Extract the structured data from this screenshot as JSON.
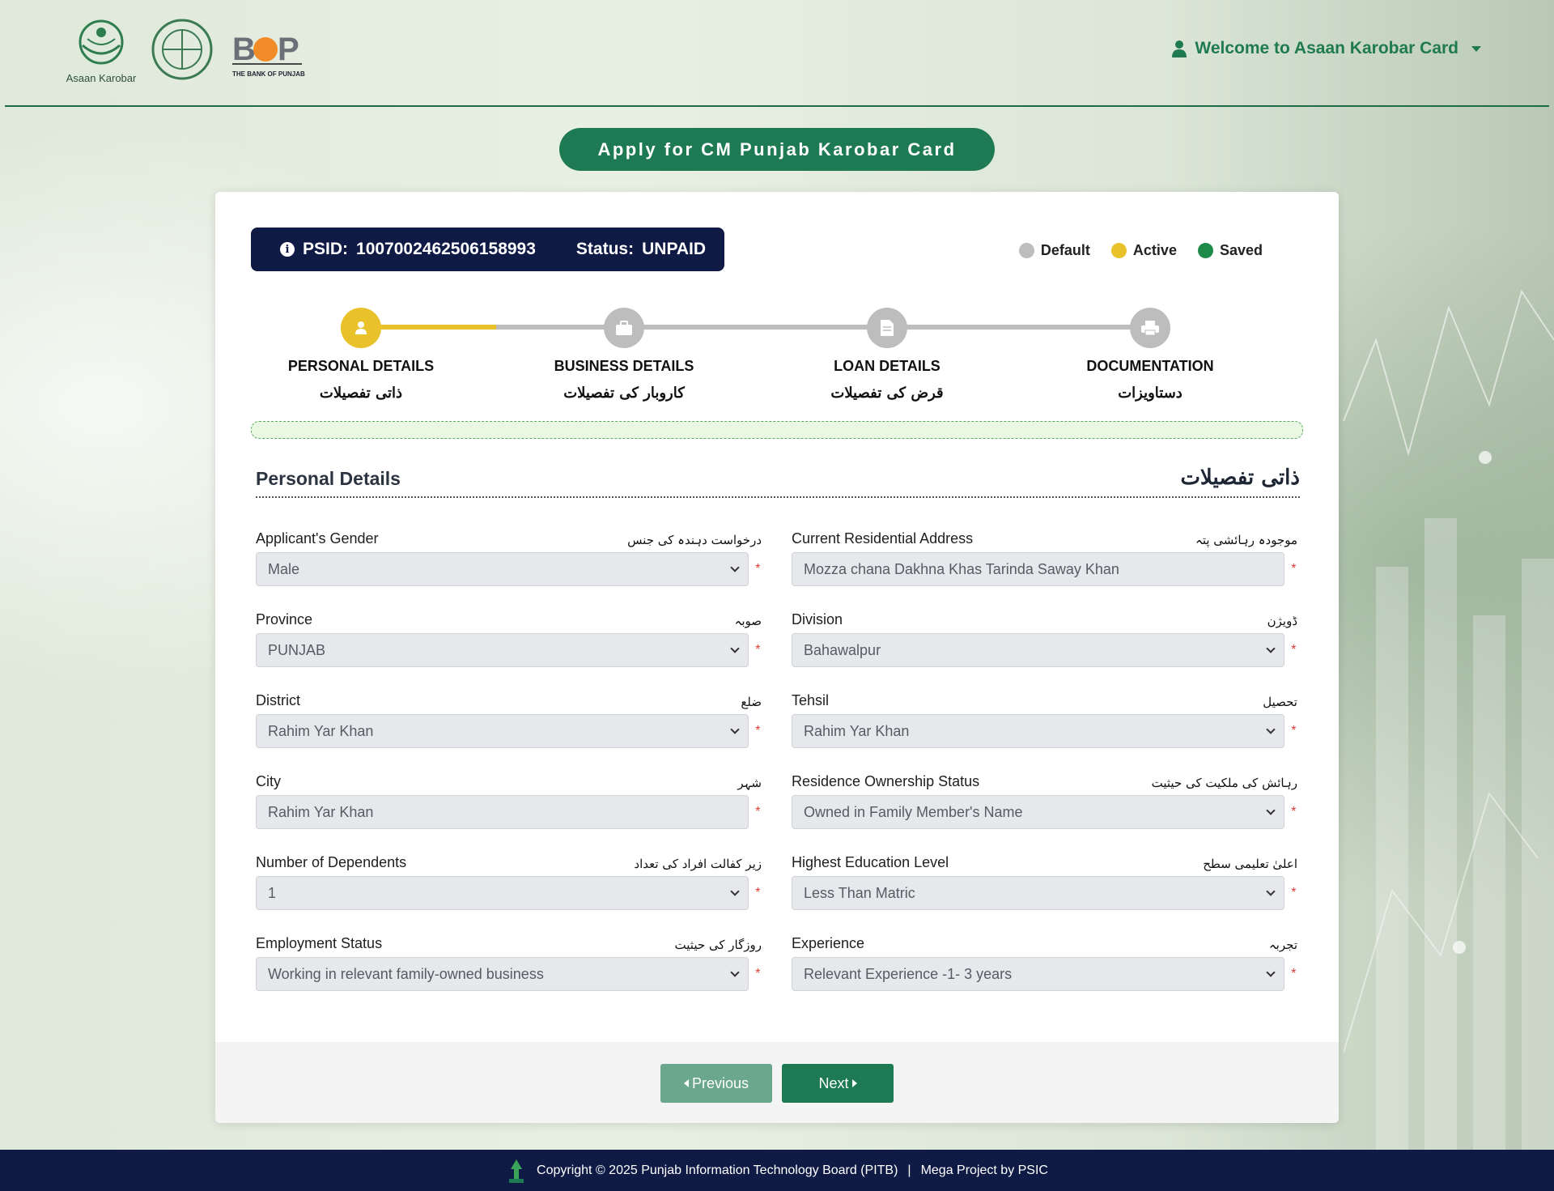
{
  "header": {
    "logo1_caption": "Asaan Karobar",
    "logo3_text": "BOP",
    "logo3_caption": "THE BANK OF PUNJAB",
    "welcome": "Welcome to Asaan Karobar Card"
  },
  "apply_title": "Apply for CM Punjab Karobar Card",
  "status_box": {
    "psid_label": "PSID:",
    "psid_value": "1007002462506158993",
    "status_label": "Status:",
    "status_value": "UNPAID"
  },
  "legend": [
    {
      "label": "Default",
      "color": "#bdbdbd"
    },
    {
      "label": "Active",
      "color": "#e9c12a"
    },
    {
      "label": "Saved",
      "color": "#1d8a4a"
    }
  ],
  "steps": [
    {
      "title": "PERSONAL DETAILS",
      "urdu": "ذاتی تفصیلات",
      "state": "active",
      "icon": "person-icon"
    },
    {
      "title": "BUSINESS DETAILS",
      "urdu": "کاروبار کی تفصیلات",
      "state": "default",
      "icon": "briefcase-icon"
    },
    {
      "title": "LOAN DETAILS",
      "urdu": "قرض کی تفصیلات",
      "state": "default",
      "icon": "document-icon"
    },
    {
      "title": "DOCUMENTATION",
      "urdu": "دستاویزات",
      "state": "default",
      "icon": "printer-icon"
    }
  ],
  "section": {
    "title": "Personal Details",
    "urdu": "ذاتی تفصیلات"
  },
  "fields": {
    "gender": {
      "label": "Applicant's Gender",
      "urdu": "درخواست دہندہ کی جنس",
      "value": "Male",
      "type": "select"
    },
    "address": {
      "label": "Current Residential Address",
      "urdu": "موجودہ رہائشی پتہ",
      "value": "Mozza chana Dakhna Khas Tarinda Saway Khan",
      "type": "input"
    },
    "province": {
      "label": "Province",
      "urdu": "صوبہ",
      "value": "PUNJAB",
      "type": "select"
    },
    "division": {
      "label": "Division",
      "urdu": "ڈویژن",
      "value": "Bahawalpur",
      "type": "select"
    },
    "district": {
      "label": "District",
      "urdu": "ضلع",
      "value": "Rahim Yar Khan",
      "type": "select"
    },
    "tehsil": {
      "label": "Tehsil",
      "urdu": "تحصیل",
      "value": "Rahim Yar Khan",
      "type": "select"
    },
    "city": {
      "label": "City",
      "urdu": "شہر",
      "value": "Rahim Yar Khan",
      "type": "input"
    },
    "ownership": {
      "label": "Residence Ownership Status",
      "urdu": "رہائش کی ملکیت کی حیثیت",
      "value": "Owned in Family Member's Name",
      "type": "select"
    },
    "dependents": {
      "label": "Number of Dependents",
      "urdu": "زیر کفالت افراد کی تعداد",
      "value": "1",
      "type": "select"
    },
    "education": {
      "label": "Highest Education Level",
      "urdu": "اعلیٰ تعلیمی سطح",
      "value": "Less Than Matric",
      "type": "select"
    },
    "employment": {
      "label": "Employment Status",
      "urdu": "روزگار کی حیثیت",
      "value": "Working in relevant family-owned business",
      "type": "select"
    },
    "experience": {
      "label": "Experience",
      "urdu": "تجربہ",
      "value": "Relevant Experience -1- 3 years",
      "type": "select"
    }
  },
  "required_mark": "*",
  "buttons": {
    "previous": "Previous",
    "next": "Next"
  },
  "footer": {
    "copyright": "Copyright © 2025 Punjab Information Technology Board (PITB)",
    "separator": "|",
    "mega": "Mega Project by PSIC"
  }
}
